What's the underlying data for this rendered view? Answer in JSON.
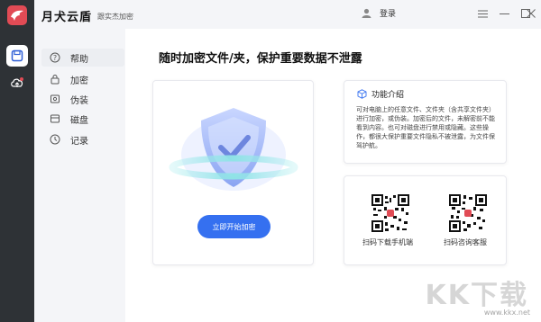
{
  "app": {
    "title": "月犬云盾",
    "subtitle": "跟实杰加密"
  },
  "header": {
    "login_label": "登录"
  },
  "nav": {
    "items": [
      {
        "label": "帮助",
        "icon": "help-icon",
        "active": true
      },
      {
        "label": "加密",
        "icon": "lock-icon"
      },
      {
        "label": "伪装",
        "icon": "disguise-icon"
      },
      {
        "label": "磁盘",
        "icon": "disk-icon"
      },
      {
        "label": "记录",
        "icon": "clock-icon"
      }
    ]
  },
  "rail": {
    "items": [
      {
        "icon": "save-icon",
        "active": true
      },
      {
        "icon": "cloud-icon"
      }
    ]
  },
  "main": {
    "title": "随时加密文件/夹，保护重要数据不泄露",
    "encrypt_button": "立即开始加密",
    "feature": {
      "title": "功能介绍",
      "text": "可对电脑上的任意文件、文件夹（含共享文件夹）进行加密，或伪装。加密后的文件，未解密前不能看到内容。也可对磁盘进行禁用或隐藏。这些操作，都很大保护重要文件隐私不被泄露，为文件保驾护航。"
    },
    "qr": [
      {
        "label": "扫码下载手机端"
      },
      {
        "label": "扫码咨询客服"
      }
    ]
  },
  "watermark": {
    "text": "KK下载",
    "url": "www.kkx.net"
  },
  "colors": {
    "accent": "#3570f0",
    "brand": "#e14b55",
    "rail": "#2e3236"
  }
}
